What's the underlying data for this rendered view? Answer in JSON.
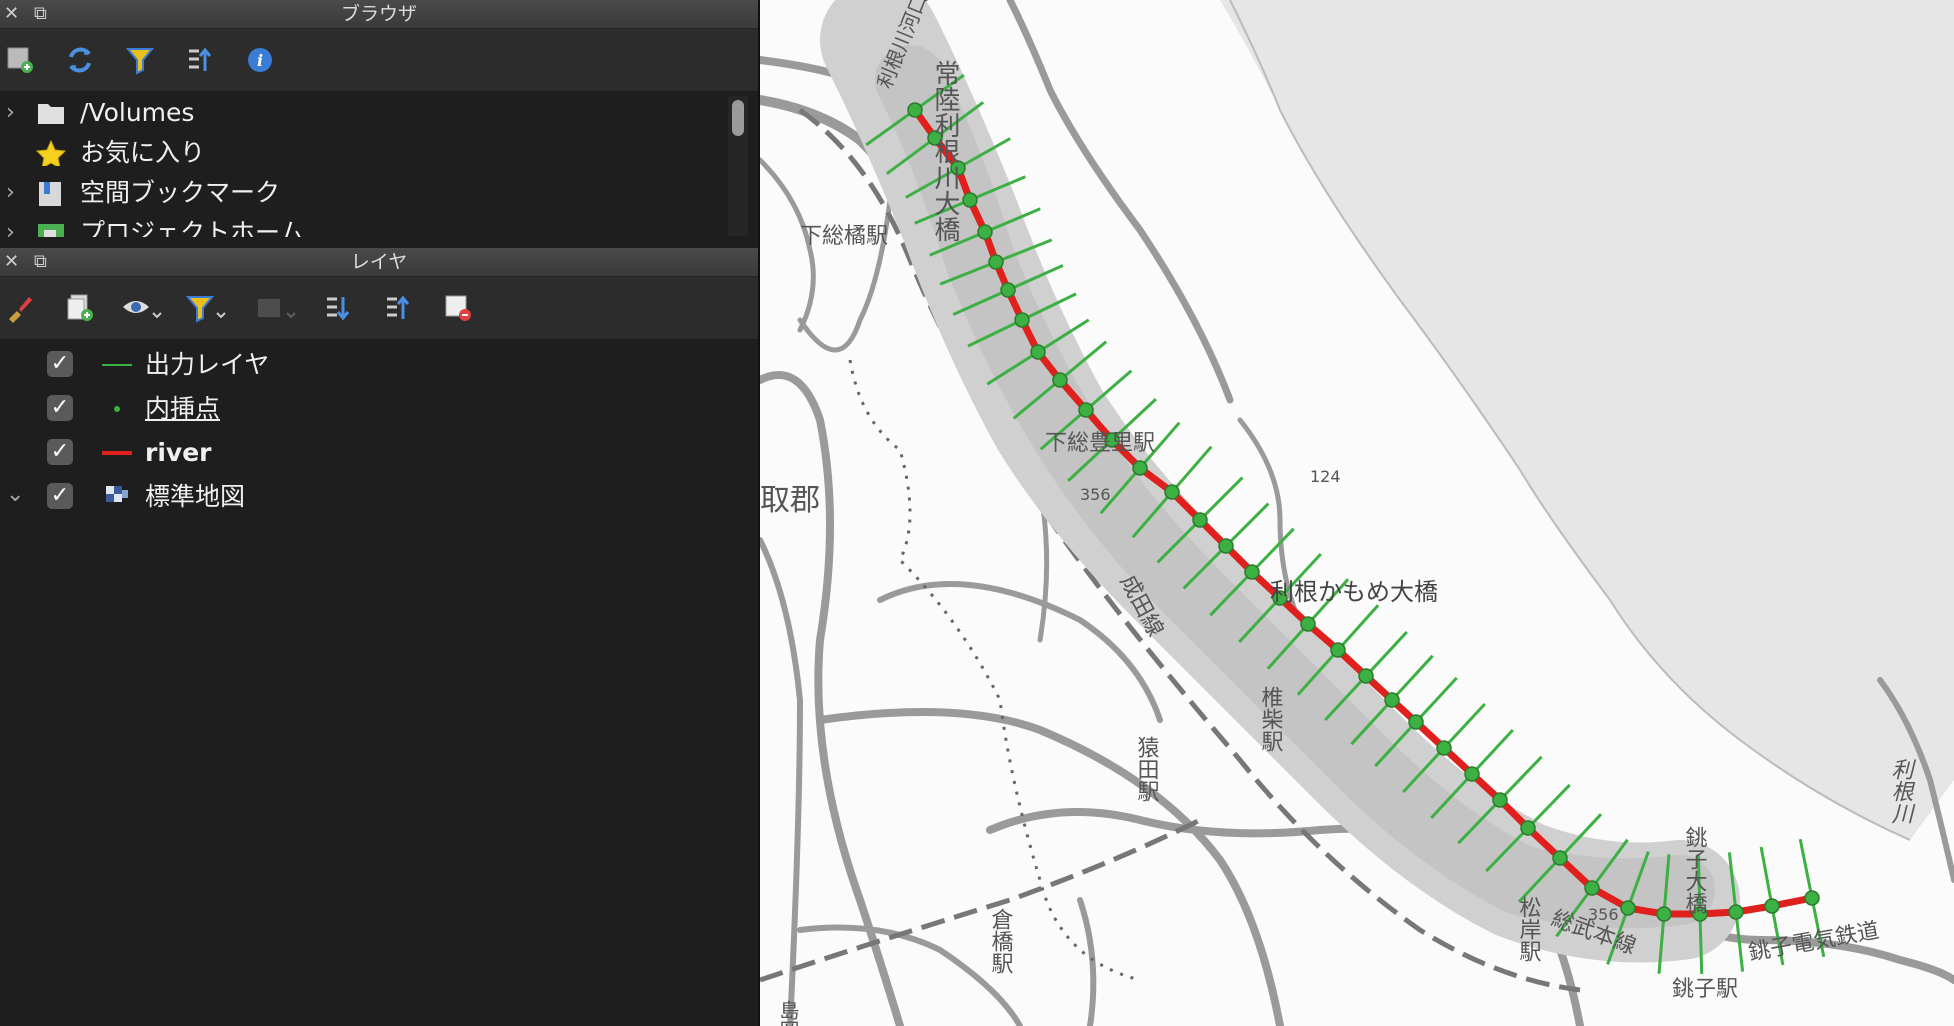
{
  "browser_panel": {
    "title": "ブラウザ",
    "toolbar": [
      "add-layer-icon",
      "refresh-icon",
      "filter-icon",
      "collapse-all-icon",
      "info-icon"
    ],
    "items": [
      {
        "label": "/Volumes",
        "icon": "folder-icon",
        "expandable": true
      },
      {
        "label": "お気に入り",
        "icon": "star-icon",
        "expandable": false
      },
      {
        "label": "空間ブックマーク",
        "icon": "bookmark-icon",
        "expandable": true
      },
      {
        "label": "プロジェクトホーム",
        "icon": "project-home-icon",
        "expandable": true
      }
    ]
  },
  "layers_panel": {
    "title": "レイヤ",
    "toolbar": [
      "style-brush-icon",
      "add-group-icon",
      "visibility-eye-icon",
      "filter-legend-icon",
      "expression-filter-icon",
      "expand-all-icon",
      "collapse-all-icon",
      "remove-layer-icon"
    ],
    "layers": [
      {
        "name": "出力レイヤ",
        "checked": true,
        "symbol": "line",
        "color": "#3cb043",
        "style": "normal"
      },
      {
        "name": "内挿点",
        "checked": true,
        "symbol": "point",
        "color": "#3cb043",
        "style": "underline"
      },
      {
        "name": "river",
        "checked": true,
        "symbol": "line",
        "color": "#e0201c",
        "style": "bold"
      },
      {
        "name": "標準地図",
        "checked": true,
        "symbol": "raster",
        "color": "#5b7bb5",
        "style": "normal"
      }
    ]
  },
  "map": {
    "labels": {
      "tone_river_left": "利根川河口",
      "hitachi_bridge": "常陸利根川大橋",
      "shimousa_tachibana": "下総橘駅",
      "shimousa_toyosato": "下総豊里駅",
      "route_356a": "356",
      "route_124": "124",
      "katori_gun": "取郡",
      "narita_line": "成田線",
      "tone_kamome": "利根かもめ大橋",
      "shiiba": "椎柴駅",
      "sarada": "猿田駅",
      "kurahashi": "倉橋駅",
      "matsugishi": "松岸駅",
      "sobu_line": "総武本線",
      "route_356b": "356",
      "choshi_bridge": "銚子大橋",
      "choshi_station": "銚子駅",
      "choshi_railway": "銚子電気鉄道",
      "tone_river_right": "利根川",
      "misc_station": "島岡"
    },
    "colors": {
      "land": "#fbfbfb",
      "sea": "#e6e6e6",
      "river_band": "#c8c8c8",
      "river_line": "#e0201c",
      "profile_lines": "#3cb043",
      "points": "#3cb043"
    }
  }
}
